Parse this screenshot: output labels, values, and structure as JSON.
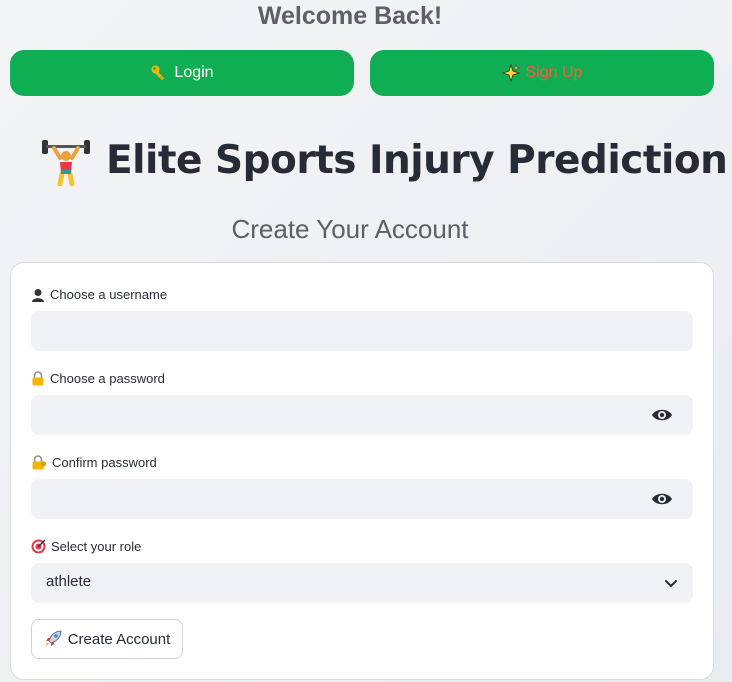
{
  "header": {
    "welcome": "Welcome Back!"
  },
  "nav": {
    "login_label": "Login",
    "signup_label": "Sign Up",
    "button_color": "#0fae52",
    "signup_text_color": "#ff5a3c"
  },
  "app": {
    "title": "Elite Sports Injury Prediction"
  },
  "form": {
    "heading": "Create Your Account",
    "username_label": "Choose a username",
    "password_label": "Choose a password",
    "confirm_label": "Confirm password",
    "role_label": "Select your role",
    "role_value": "athlete",
    "submit_label": "Create Account"
  },
  "icons": {
    "login": "key-icon",
    "signup": "sparkle-icon",
    "title": "weightlifter-icon",
    "username": "user-silhouette-icon",
    "password": "lock-icon",
    "confirm": "lock-with-key-icon",
    "role": "target-icon",
    "submit": "rocket-icon",
    "reveal": "eye-icon",
    "dropdown": "chevron-down-icon"
  }
}
